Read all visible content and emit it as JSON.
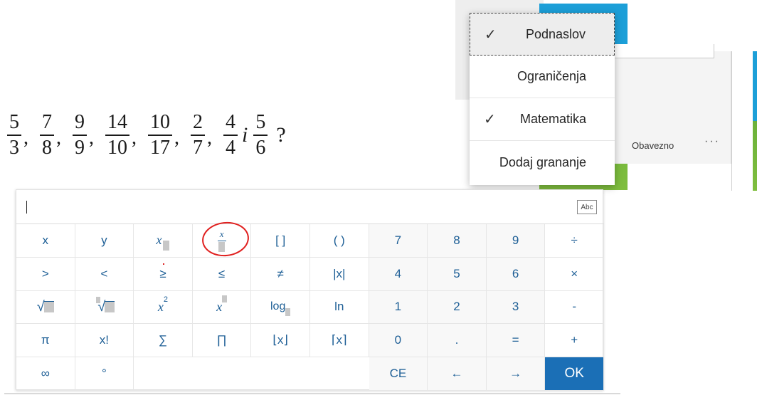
{
  "fractions": [
    {
      "num": "5",
      "den": "3"
    },
    {
      "num": "7",
      "den": "8"
    },
    {
      "num": "9",
      "den": "9"
    },
    {
      "num": "14",
      "den": "10"
    },
    {
      "num": "10",
      "den": "17"
    },
    {
      "num": "2",
      "den": "7"
    },
    {
      "num": "4",
      "den": "4"
    },
    {
      "num": "5",
      "den": "6"
    }
  ],
  "fraction_separator": ",",
  "fraction_conjunction": "i",
  "fraction_question": "?",
  "menu": {
    "items": [
      {
        "label": "Podnaslov",
        "checked": true,
        "selected": true
      },
      {
        "label": "Ograničenja",
        "checked": false
      },
      {
        "label": "Matematika",
        "checked": true
      },
      {
        "label": "Dodaj grananje",
        "checked": false
      }
    ],
    "check_glyph": "✓"
  },
  "question_settings": {
    "required_label": "Obavezno",
    "more_glyph": "···"
  },
  "keyboard": {
    "abc_label": "Abc",
    "row1": {
      "x": "x",
      "y": "y",
      "x_sub": "x",
      "frac_num": "x",
      "brackets": "[ ]",
      "parens": "( )",
      "n7": "7",
      "n8": "8",
      "n9": "9",
      "div": "÷"
    },
    "row2": {
      "gt": ">",
      "lt": "<",
      "ge": "≥",
      "le": "≤",
      "ne": "≠",
      "abs": "|x|",
      "n4": "4",
      "n5": "5",
      "n6": "6",
      "mul": "×"
    },
    "row3": {
      "sqrt": "√",
      "nroot": "√",
      "x_base": "x",
      "sq_exp": "2",
      "x_pow": "x",
      "log": "log",
      "ln": "ln",
      "n1": "1",
      "n2": "2",
      "n3": "3",
      "minus": "-"
    },
    "row4": {
      "pi": "π",
      "fact": "x!",
      "sum": "∑",
      "prod": "∏",
      "floor": "⌊x⌋",
      "ceil": "⌈x⌉",
      "n0": "0",
      "dot": ".",
      "eq": "=",
      "plus": "+"
    },
    "row5": {
      "inf": "∞",
      "deg": "°",
      "ce": "CE",
      "left": "←",
      "right": "→",
      "ok": "OK"
    }
  },
  "colors": {
    "key_text": "#1e5f96",
    "ok_bg": "#1b6fb6",
    "annotation": "#e0201f",
    "forms_blue": "#1c9fd8",
    "forms_green": "#6bb13a"
  }
}
